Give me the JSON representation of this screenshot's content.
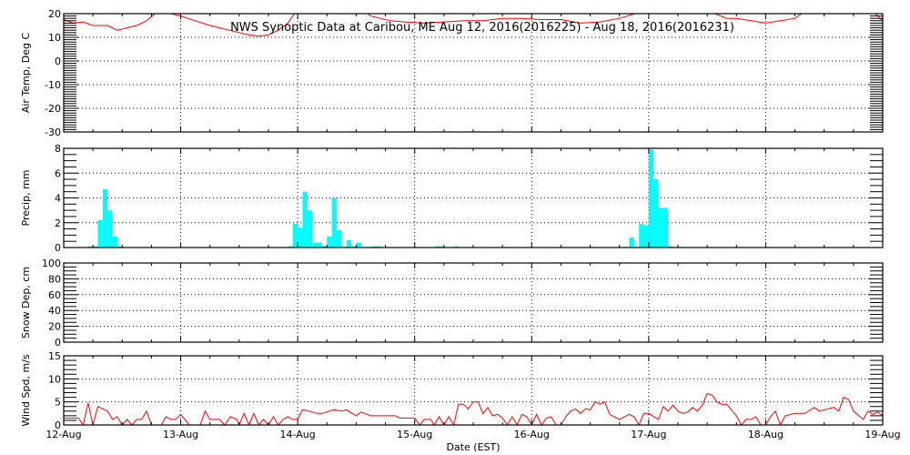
{
  "chart_data": {
    "type": "multi-panel",
    "title": "NWS Synoptic Data at Caribou, ME   Aug 12, 2016(2016225) - Aug 18, 2016(2016231)",
    "xlabel": "Date (EST)",
    "x_unit": "hours since 12-Aug 00:00",
    "x_range_hours": [
      0,
      168
    ],
    "x_tick_labels": [
      "12-Aug",
      "13-Aug",
      "14-Aug",
      "15-Aug",
      "16-Aug",
      "17-Aug",
      "18-Aug",
      "19-Aug"
    ],
    "panels": [
      {
        "id": "air-temp",
        "type": "line",
        "ylabel": "Air Temp, Deg C",
        "ylim": [
          -30,
          20
        ],
        "yticks": [
          -30,
          -20,
          -10,
          0,
          10,
          20
        ],
        "minor_step": 1,
        "color": "#ff0000",
        "points": [
          [
            0,
            17.5
          ],
          [
            2,
            16
          ],
          [
            4,
            16.5
          ],
          [
            6,
            15
          ],
          [
            9,
            15
          ],
          [
            11,
            13
          ],
          [
            13,
            14
          ],
          [
            15,
            15
          ],
          [
            17,
            17
          ],
          [
            19,
            20.5
          ],
          [
            22,
            20
          ],
          [
            24,
            19
          ],
          [
            27,
            17
          ],
          [
            30,
            15
          ],
          [
            32,
            14
          ],
          [
            34,
            13
          ],
          [
            36,
            12
          ],
          [
            38,
            11
          ],
          [
            40,
            10.5
          ],
          [
            42,
            11
          ],
          [
            44,
            13
          ],
          [
            46,
            16
          ],
          [
            47,
            19
          ],
          [
            48,
            22
          ],
          [
            61,
            22
          ],
          [
            63,
            19
          ],
          [
            65,
            18
          ],
          [
            67,
            17
          ],
          [
            70,
            16.5
          ],
          [
            74,
            16
          ],
          [
            78,
            16.5
          ],
          [
            82,
            17
          ],
          [
            86,
            17
          ],
          [
            90,
            18
          ],
          [
            94,
            18
          ],
          [
            98,
            17.5
          ],
          [
            102,
            17.5
          ],
          [
            106,
            16
          ],
          [
            110,
            16.5
          ],
          [
            114,
            18
          ],
          [
            118,
            20.5
          ],
          [
            133,
            20.5
          ],
          [
            136,
            18
          ],
          [
            138,
            18
          ],
          [
            141,
            17
          ],
          [
            144,
            16
          ],
          [
            147,
            17
          ],
          [
            150,
            18
          ],
          [
            152,
            21
          ],
          [
            166,
            21
          ],
          [
            167,
            19
          ],
          [
            168,
            17
          ]
        ]
      },
      {
        "id": "precip",
        "type": "bar",
        "ylabel": "Precip, mm",
        "ylim": [
          0,
          8
        ],
        "yticks": [
          0,
          2,
          4,
          6,
          8
        ],
        "minor_step": 0.5,
        "color": "#00ffff",
        "bar_width_hours": 1,
        "points": [
          [
            5,
            0.1
          ],
          [
            6,
            0.1
          ],
          [
            7,
            2.2
          ],
          [
            8,
            4.7
          ],
          [
            9,
            3.0
          ],
          [
            10,
            0.9
          ],
          [
            11,
            0.1
          ],
          [
            46,
            0.1
          ],
          [
            47,
            1.9
          ],
          [
            48,
            1.6
          ],
          [
            49,
            4.5
          ],
          [
            50,
            3.0
          ],
          [
            51,
            0.4
          ],
          [
            52,
            0.4
          ],
          [
            53,
            0.1
          ],
          [
            54,
            0.9
          ],
          [
            55,
            4.0
          ],
          [
            56,
            1.4
          ],
          [
            58,
            0.6
          ],
          [
            59,
            0.1
          ],
          [
            60,
            0.4
          ],
          [
            63,
            0.1
          ],
          [
            64,
            0.1
          ],
          [
            76,
            0.1
          ],
          [
            77,
            0.1
          ],
          [
            80,
            0.1
          ],
          [
            116,
            0.8
          ],
          [
            118,
            1.9
          ],
          [
            119,
            1.8
          ],
          [
            120,
            7.9
          ],
          [
            121,
            5.5
          ],
          [
            122,
            3.2
          ],
          [
            123,
            3.2
          ],
          [
            124,
            0.1
          ]
        ]
      },
      {
        "id": "snow-depth",
        "type": "line",
        "ylabel": "Snow Dep, cm",
        "ylim": [
          0,
          100
        ],
        "yticks": [
          0,
          20,
          40,
          60,
          80,
          100
        ],
        "minor_step": 5,
        "color": "#ff0000",
        "points": []
      },
      {
        "id": "wind-speed",
        "type": "line",
        "ylabel": "Wind Spd, m/s",
        "ylim": [
          0,
          15
        ],
        "yticks": [
          0,
          5,
          10,
          15
        ],
        "minor_step": 1,
        "color": "#ff0000",
        "points": [
          [
            0,
            1.5
          ],
          [
            3,
            1.5
          ],
          [
            4,
            0
          ],
          [
            5,
            4.8
          ],
          [
            6,
            0
          ],
          [
            7,
            4
          ],
          [
            9,
            3
          ],
          [
            10,
            1.2
          ],
          [
            11,
            1.8
          ],
          [
            12,
            0
          ],
          [
            13,
            1.2
          ],
          [
            14,
            0
          ],
          [
            15,
            1.2
          ],
          [
            16,
            1.2
          ],
          [
            17,
            3
          ],
          [
            18,
            0
          ],
          [
            20,
            0
          ],
          [
            21,
            1.8
          ],
          [
            22,
            1.2
          ],
          [
            23,
            1.2
          ],
          [
            24,
            2.3
          ],
          [
            25.8,
            0
          ],
          [
            28,
            0
          ],
          [
            29,
            3
          ],
          [
            30,
            1.2
          ],
          [
            32,
            1.2
          ],
          [
            33,
            0
          ],
          [
            34.2,
            1.8
          ],
          [
            35.5,
            1.2
          ],
          [
            36,
            0
          ],
          [
            37,
            2.5
          ],
          [
            38,
            0
          ],
          [
            39,
            2.5
          ],
          [
            40,
            0
          ],
          [
            41,
            1.2
          ],
          [
            42,
            0
          ],
          [
            43,
            1.8
          ],
          [
            44,
            0
          ],
          [
            45,
            1.2
          ],
          [
            46,
            1.8
          ],
          [
            47,
            1.2
          ],
          [
            48,
            1.2
          ],
          [
            49,
            3.3
          ],
          [
            50.4,
            3
          ],
          [
            52,
            2.5
          ],
          [
            53,
            2.5
          ],
          [
            55.4,
            3.3
          ],
          [
            57,
            3
          ],
          [
            58,
            3.3
          ],
          [
            60,
            2
          ],
          [
            61,
            2.8
          ],
          [
            63,
            2
          ],
          [
            68,
            2
          ],
          [
            69,
            1.5
          ],
          [
            72,
            1.5
          ],
          [
            73,
            0
          ],
          [
            74,
            1.2
          ],
          [
            75.3,
            1.2
          ],
          [
            76,
            0
          ],
          [
            77,
            1.8
          ],
          [
            78,
            0
          ],
          [
            79,
            1.8
          ],
          [
            80,
            0
          ],
          [
            81,
            4.5
          ],
          [
            82,
            4.5
          ],
          [
            83,
            3.5
          ],
          [
            84,
            5
          ],
          [
            85,
            5
          ],
          [
            86,
            2.5
          ],
          [
            87,
            3.8
          ],
          [
            88,
            2
          ],
          [
            89,
            2.3
          ],
          [
            90,
            1.5
          ],
          [
            91,
            0
          ],
          [
            92,
            1.8
          ],
          [
            93,
            0
          ],
          [
            94,
            2.3
          ],
          [
            95,
            1.8
          ],
          [
            96,
            0
          ],
          [
            97,
            2.3
          ],
          [
            98,
            0
          ],
          [
            99,
            1.5
          ],
          [
            100,
            1.8
          ],
          [
            101,
            0
          ],
          [
            102,
            0
          ],
          [
            103,
            1.8
          ],
          [
            104,
            3
          ],
          [
            105,
            3.5
          ],
          [
            106,
            2.5
          ],
          [
            107,
            3.5
          ],
          [
            108,
            3.3
          ],
          [
            109,
            5
          ],
          [
            110,
            4.5
          ],
          [
            111,
            5
          ],
          [
            112,
            2.3
          ],
          [
            114,
            1.2
          ],
          [
            116,
            2.3
          ],
          [
            117,
            1.8
          ],
          [
            118,
            0
          ],
          [
            119,
            2.5
          ],
          [
            120,
            2.5
          ],
          [
            122,
            1.2
          ],
          [
            123,
            4
          ],
          [
            124,
            3
          ],
          [
            125,
            4.3
          ],
          [
            126,
            3
          ],
          [
            127,
            2.5
          ],
          [
            128,
            2.8
          ],
          [
            129,
            3.8
          ],
          [
            130,
            3
          ],
          [
            131,
            4.3
          ],
          [
            132,
            6.8
          ],
          [
            133,
            6.5
          ],
          [
            134,
            5
          ],
          [
            135,
            4.5
          ],
          [
            136,
            4.5
          ],
          [
            138,
            2
          ],
          [
            139,
            0
          ],
          [
            140,
            1.2
          ],
          [
            141,
            1.2
          ],
          [
            142,
            1.8
          ],
          [
            143,
            0
          ],
          [
            144,
            0
          ],
          [
            145,
            1.8
          ],
          [
            146,
            3
          ],
          [
            147,
            0
          ],
          [
            148,
            2
          ],
          [
            150,
            2.5
          ],
          [
            152,
            2.5
          ],
          [
            154,
            3.8
          ],
          [
            155,
            3
          ],
          [
            156,
            3.3
          ],
          [
            158,
            3.8
          ],
          [
            159,
            3
          ],
          [
            160,
            6
          ],
          [
            161,
            5.5
          ],
          [
            162,
            3
          ],
          [
            164,
            1.2
          ],
          [
            165,
            3
          ],
          [
            166,
            2.3
          ],
          [
            167,
            2.8
          ],
          [
            168,
            2
          ]
        ]
      }
    ]
  }
}
